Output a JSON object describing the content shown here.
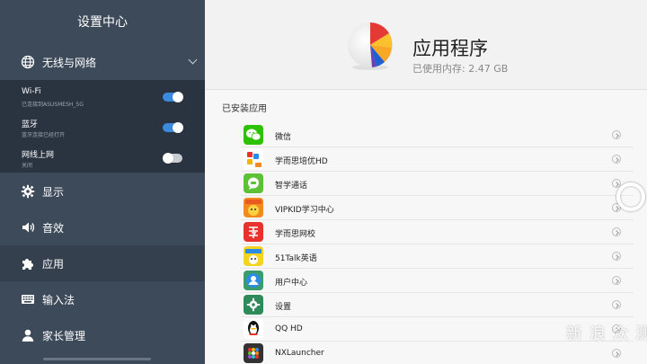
{
  "sidebar": {
    "title": "设置中心",
    "network": {
      "label": "无线与网络",
      "icon": "globe-icon"
    },
    "sub_items": [
      {
        "title": "Wi-Fi",
        "desc": "已连接到ASUSMESH_5G",
        "toggle": "on"
      },
      {
        "title": "蓝牙",
        "desc": "蓝牙连接已经打开",
        "toggle": "on"
      },
      {
        "title": "网线上网",
        "desc": "关闭",
        "toggle": "off"
      }
    ],
    "items": [
      {
        "label": "显示",
        "icon": "gear-icon"
      },
      {
        "label": "音效",
        "icon": "speaker-icon"
      },
      {
        "label": "应用",
        "icon": "puzzle-icon"
      },
      {
        "label": "输入法",
        "icon": "keyboard-icon"
      },
      {
        "label": "家长管理",
        "icon": "user-icon"
      }
    ]
  },
  "main": {
    "title": "应用程序",
    "storage": "已使用内存: 2.47 GB",
    "installed_label": "已安装应用",
    "apps": [
      {
        "name": "微信",
        "icon": "wechat-icon",
        "color": "#2dc100"
      },
      {
        "name": "学而思培优HD",
        "icon": "xueersi-peiyou-icon",
        "color": "#ffffff"
      },
      {
        "name": "智学通话",
        "icon": "chat-bubble-icon",
        "color": "#5bc236"
      },
      {
        "name": "VIPKID学习中心",
        "icon": "vipkid-icon",
        "color": "#f28a1f"
      },
      {
        "name": "学而思网校",
        "icon": "xueersi-wangxiao-icon",
        "color": "#e8322d"
      },
      {
        "name": "51Talk英语",
        "icon": "51talk-icon",
        "color": "#f5d321"
      },
      {
        "name": "用户中心",
        "icon": "user-center-icon",
        "color": "#3a9c6a"
      },
      {
        "name": "设置",
        "icon": "settings-icon",
        "color": "#2f8a5a"
      },
      {
        "name": "QQ HD",
        "icon": "qq-penguin-icon",
        "color": "#ffffff"
      },
      {
        "name": "NXLauncher",
        "icon": "nxlauncher-icon",
        "color": "#333333"
      }
    ]
  },
  "watermark": "新 浪 众 测"
}
